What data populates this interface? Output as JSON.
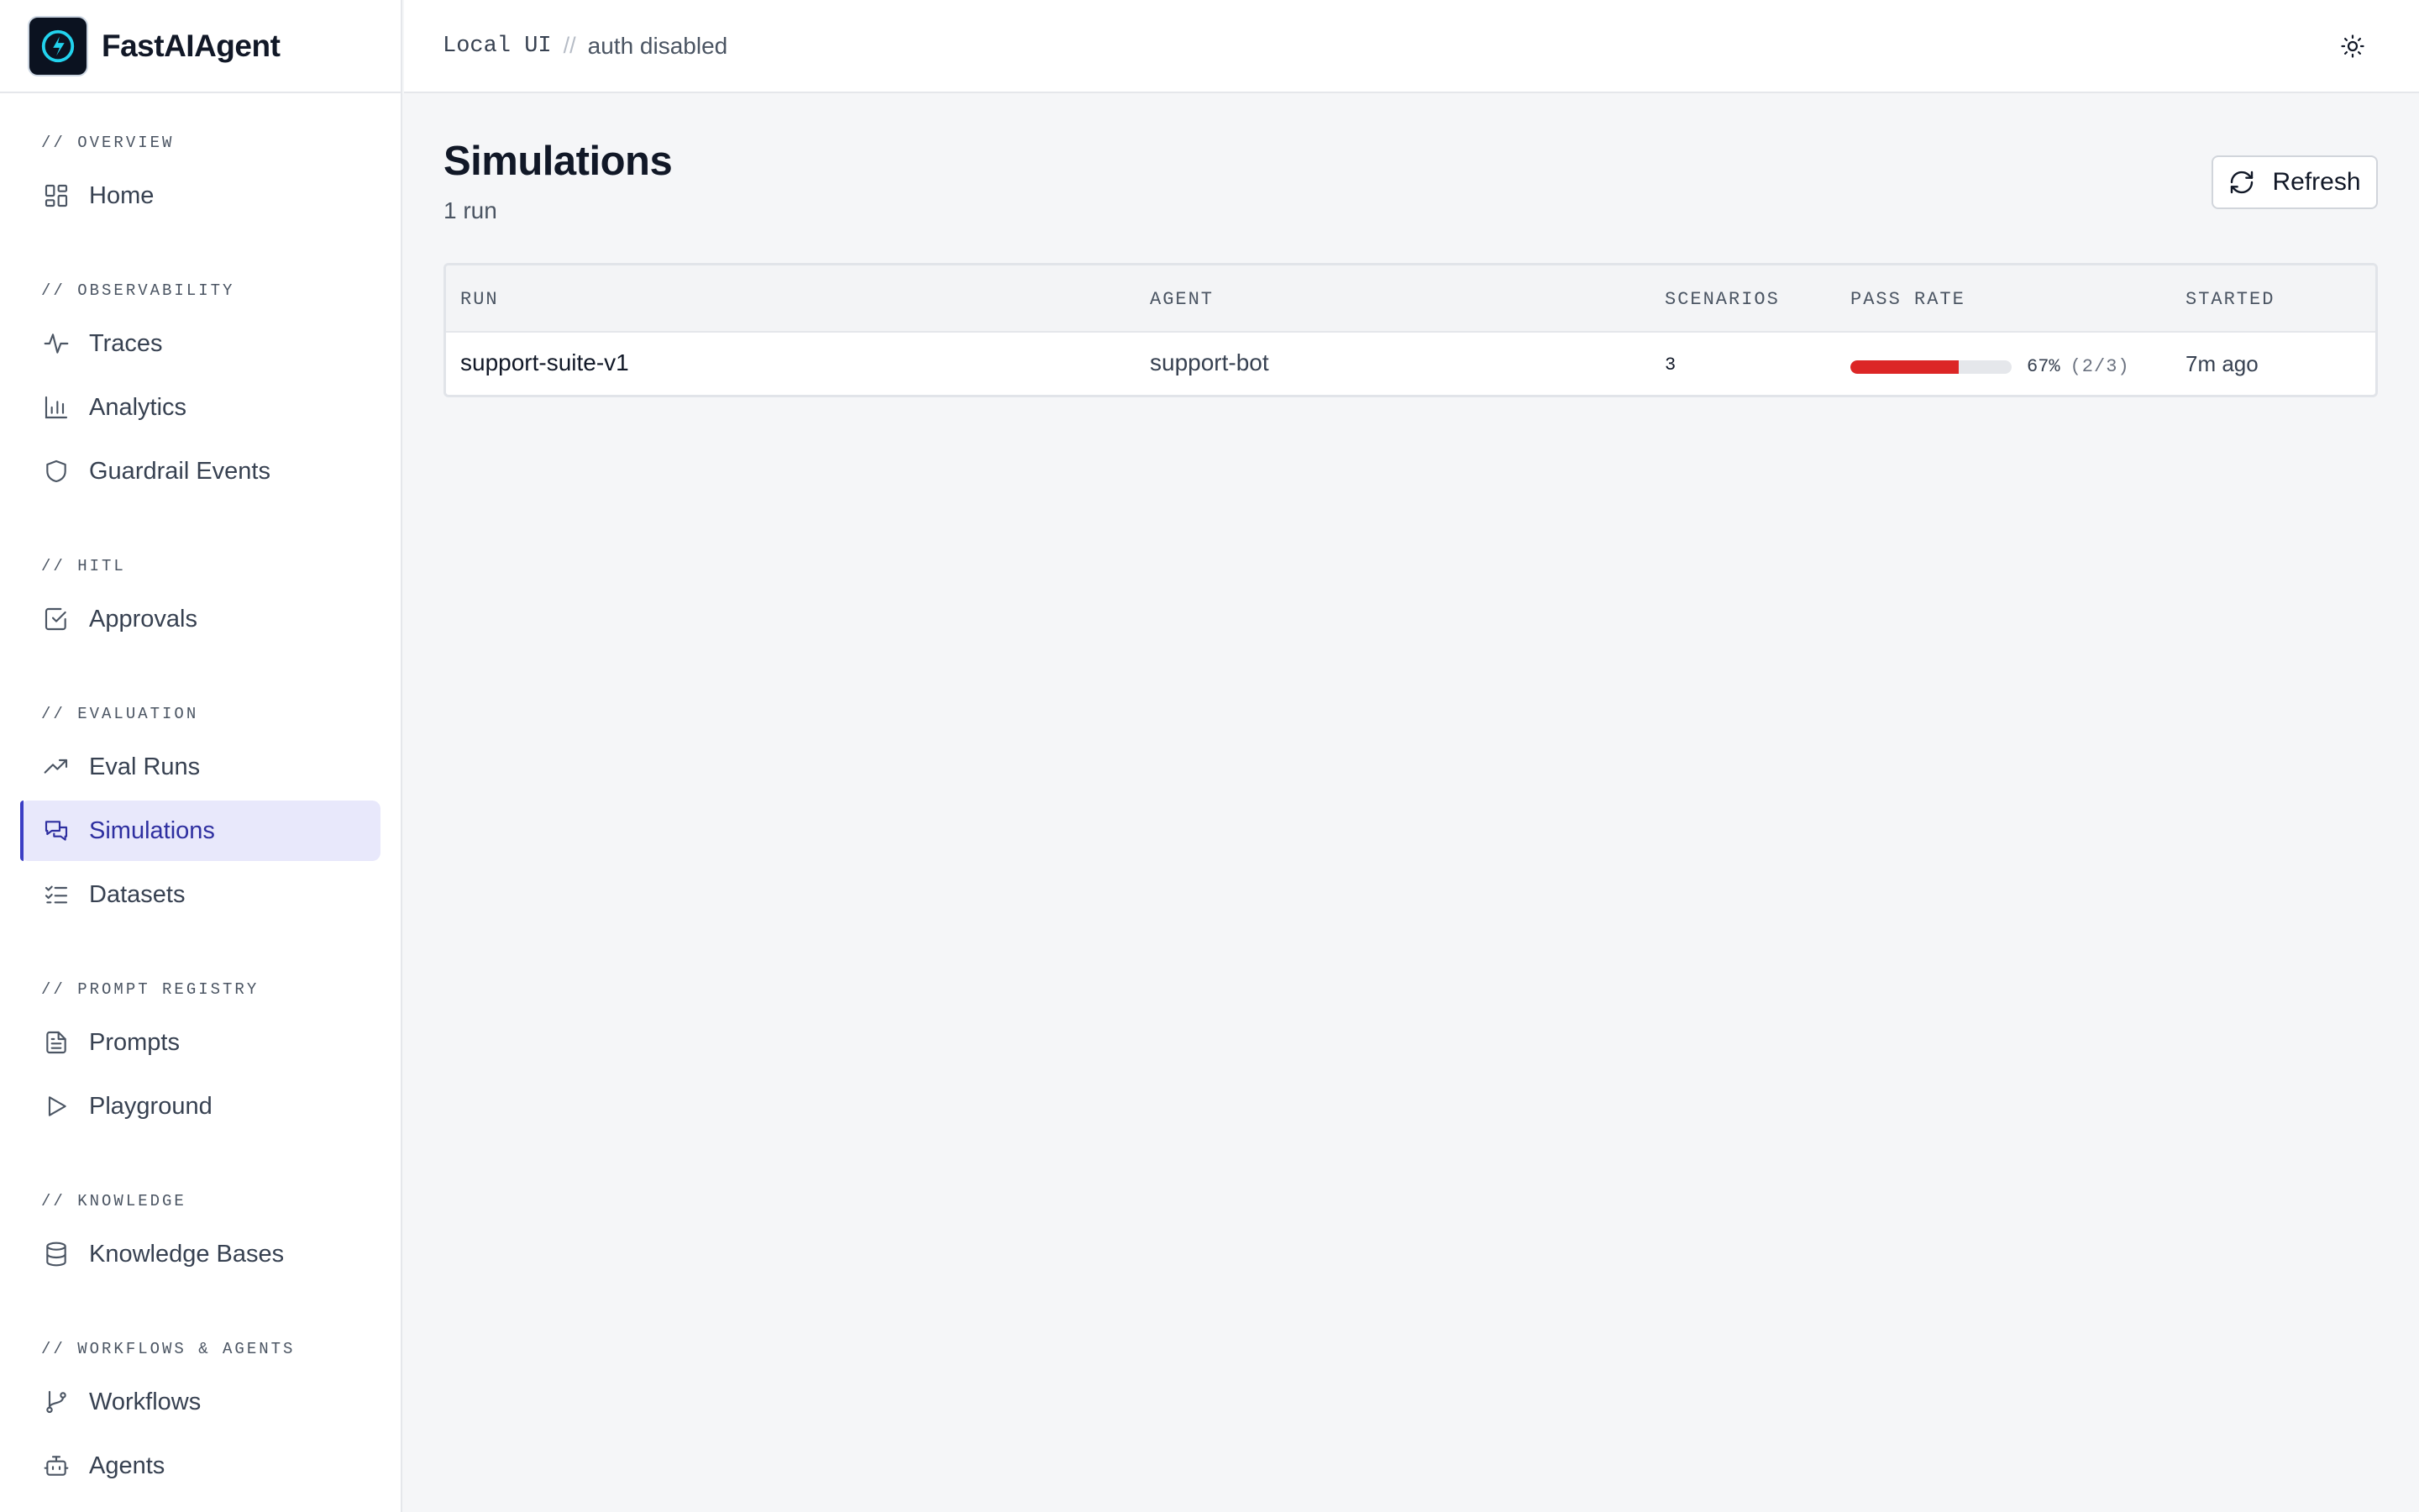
{
  "brand": {
    "name": "FastAIAgent"
  },
  "header": {
    "mode": "Local UI",
    "separator": "//",
    "auth": "auth disabled"
  },
  "sidebar": {
    "sections": [
      {
        "label": "// OVERVIEW",
        "items": [
          {
            "label": "Home",
            "icon": "grid-icon"
          }
        ]
      },
      {
        "label": "// OBSERVABILITY",
        "items": [
          {
            "label": "Traces",
            "icon": "activity-icon"
          },
          {
            "label": "Analytics",
            "icon": "bar-chart-icon"
          },
          {
            "label": "Guardrail Events",
            "icon": "shield-icon"
          }
        ]
      },
      {
        "label": "// HITL",
        "items": [
          {
            "label": "Approvals",
            "icon": "check-square-icon"
          }
        ]
      },
      {
        "label": "// EVALUATION",
        "items": [
          {
            "label": "Eval Runs",
            "icon": "trending-up-icon"
          },
          {
            "label": "Simulations",
            "icon": "messages-icon",
            "active": true
          },
          {
            "label": "Datasets",
            "icon": "list-checks-icon"
          }
        ]
      },
      {
        "label": "// PROMPT REGISTRY",
        "items": [
          {
            "label": "Prompts",
            "icon": "file-text-icon"
          },
          {
            "label": "Playground",
            "icon": "play-icon"
          }
        ]
      },
      {
        "label": "// KNOWLEDGE",
        "items": [
          {
            "label": "Knowledge Bases",
            "icon": "database-icon"
          }
        ]
      },
      {
        "label": "// WORKFLOWS & AGENTS",
        "items": [
          {
            "label": "Workflows",
            "icon": "git-branch-icon"
          },
          {
            "label": "Agents",
            "icon": "bot-icon"
          }
        ]
      }
    ]
  },
  "page": {
    "title": "Simulations",
    "subtitle": "1 run",
    "refresh_label": "Refresh"
  },
  "table": {
    "columns": [
      "RUN",
      "AGENT",
      "SCENARIOS",
      "PASS RATE",
      "STARTED"
    ],
    "rows": [
      {
        "run": "support-suite-v1",
        "agent": "support-bot",
        "scenarios": "3",
        "pass_rate_pct": "67%",
        "pass_fraction": "(2/3)",
        "pass_rate_value": 0.67,
        "started": "7m ago"
      }
    ]
  },
  "colors": {
    "accent": "#3b3ec4",
    "active_bg": "#e8e8fb",
    "fail_bar": "#dc2626"
  }
}
